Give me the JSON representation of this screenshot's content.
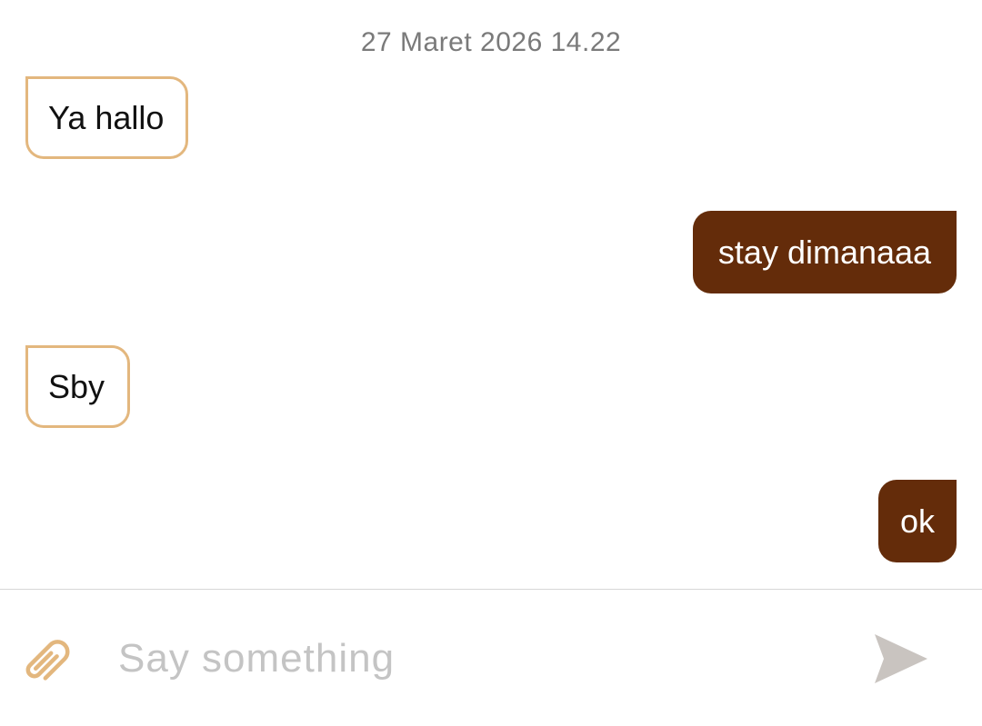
{
  "conversation": {
    "timestamp": "27 Maret 2026 14.22",
    "messages": [
      {
        "direction": "incoming",
        "text": "Ya hallo"
      },
      {
        "direction": "outgoing",
        "text": "stay dimanaaa"
      },
      {
        "direction": "incoming",
        "text": "Sby"
      },
      {
        "direction": "outgoing",
        "text": "ok"
      }
    ]
  },
  "composer": {
    "placeholder": "Say something",
    "attach_icon": "paperclip-icon",
    "send_icon": "send-icon"
  },
  "colors": {
    "outgoing_bubble": "#642c0a",
    "incoming_border": "#e3b77e",
    "accent_icon": "#e3b77e",
    "send_icon": "#c9c4c0"
  }
}
